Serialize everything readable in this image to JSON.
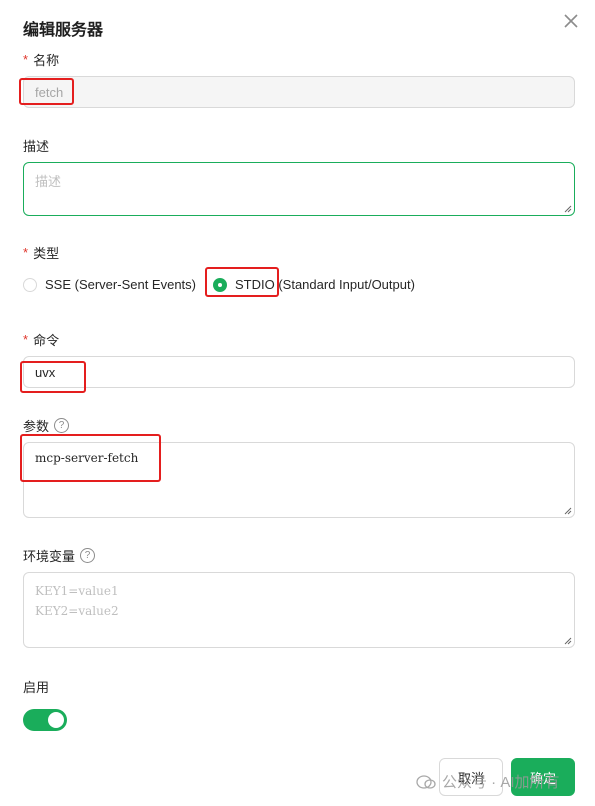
{
  "dialog": {
    "title": "编辑服务器",
    "fields": {
      "name": {
        "label": "名称",
        "required_mark": "*",
        "value": "fetch"
      },
      "description": {
        "label": "描述",
        "placeholder": "描述",
        "value": ""
      },
      "type": {
        "label": "类型",
        "required_mark": "*",
        "options": [
          "SSE (Server-Sent Events)",
          "STDIO (Standard Input/Output)"
        ],
        "selected": "STDIO (Standard Input/Output)"
      },
      "command": {
        "label": "命令",
        "required_mark": "*",
        "value": "uvx"
      },
      "args": {
        "label": "参数",
        "help_icon": "question-circle-icon",
        "value": "mcp-server-fetch"
      },
      "env": {
        "label": "环境变量",
        "help_icon": "question-circle-icon",
        "placeholder_line1": "KEY1=value1",
        "placeholder_line2": "KEY2=value2"
      },
      "enabled": {
        "label": "启用",
        "on": true
      }
    },
    "buttons": {
      "cancel": "取消",
      "ok": "确定"
    }
  },
  "watermark": {
    "text": "公众号 · AI加所有"
  },
  "colors": {
    "accent": "#1aad5b",
    "required": "#e0352b",
    "highlight_box": "#e41e1e"
  },
  "icons": {
    "close": "close-icon",
    "help": "question-circle-icon",
    "watermark": "wechat-icon"
  }
}
